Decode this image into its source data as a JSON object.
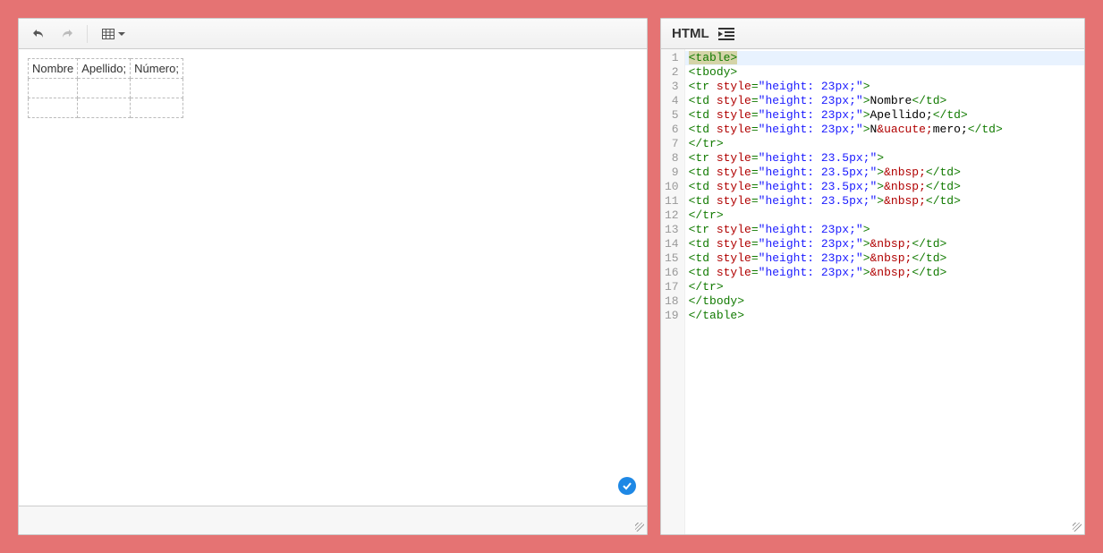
{
  "editor": {
    "table": {
      "rows": [
        {
          "cells": [
            "Nombre",
            "Apellido;",
            "Número;"
          ]
        },
        {
          "cells": [
            "",
            "",
            ""
          ]
        },
        {
          "cells": [
            "",
            "",
            ""
          ]
        }
      ]
    }
  },
  "code_panel": {
    "title": "HTML",
    "lines": [
      {
        "n": 1,
        "tokens": [
          {
            "t": "<table>",
            "c": "tag",
            "sel": true
          }
        ]
      },
      {
        "n": 2,
        "tokens": [
          {
            "t": "<tbody>",
            "c": "tag"
          }
        ]
      },
      {
        "n": 3,
        "tokens": [
          {
            "t": "<tr ",
            "c": "tag"
          },
          {
            "t": "style",
            "c": "attr"
          },
          {
            "t": "=",
            "c": "tag"
          },
          {
            "t": "\"height: 23px;\"",
            "c": "str"
          },
          {
            "t": ">",
            "c": "tag"
          }
        ]
      },
      {
        "n": 4,
        "tokens": [
          {
            "t": "<td ",
            "c": "tag"
          },
          {
            "t": "style",
            "c": "attr"
          },
          {
            "t": "=",
            "c": "tag"
          },
          {
            "t": "\"height: 23px;\"",
            "c": "str"
          },
          {
            "t": ">",
            "c": "tag"
          },
          {
            "t": "Nombre",
            "c": "text"
          },
          {
            "t": "</td>",
            "c": "tag"
          }
        ]
      },
      {
        "n": 5,
        "tokens": [
          {
            "t": "<td ",
            "c": "tag"
          },
          {
            "t": "style",
            "c": "attr"
          },
          {
            "t": "=",
            "c": "tag"
          },
          {
            "t": "\"height: 23px;\"",
            "c": "str"
          },
          {
            "t": ">",
            "c": "tag"
          },
          {
            "t": "Apellido;",
            "c": "text"
          },
          {
            "t": "</td>",
            "c": "tag"
          }
        ]
      },
      {
        "n": 6,
        "tokens": [
          {
            "t": "<td ",
            "c": "tag"
          },
          {
            "t": "style",
            "c": "attr"
          },
          {
            "t": "=",
            "c": "tag"
          },
          {
            "t": "\"height: 23px;\"",
            "c": "str"
          },
          {
            "t": ">",
            "c": "tag"
          },
          {
            "t": "N",
            "c": "text"
          },
          {
            "t": "&uacute;",
            "c": "ent"
          },
          {
            "t": "mero;",
            "c": "text"
          },
          {
            "t": "</td>",
            "c": "tag"
          }
        ]
      },
      {
        "n": 7,
        "tokens": [
          {
            "t": "</tr>",
            "c": "tag"
          }
        ]
      },
      {
        "n": 8,
        "tokens": [
          {
            "t": "<tr ",
            "c": "tag"
          },
          {
            "t": "style",
            "c": "attr"
          },
          {
            "t": "=",
            "c": "tag"
          },
          {
            "t": "\"height: 23.5px;\"",
            "c": "str"
          },
          {
            "t": ">",
            "c": "tag"
          }
        ]
      },
      {
        "n": 9,
        "tokens": [
          {
            "t": "<td ",
            "c": "tag"
          },
          {
            "t": "style",
            "c": "attr"
          },
          {
            "t": "=",
            "c": "tag"
          },
          {
            "t": "\"height: 23.5px;\"",
            "c": "str"
          },
          {
            "t": ">",
            "c": "tag"
          },
          {
            "t": "&nbsp;",
            "c": "ent"
          },
          {
            "t": "</td>",
            "c": "tag"
          }
        ]
      },
      {
        "n": 10,
        "tokens": [
          {
            "t": "<td ",
            "c": "tag"
          },
          {
            "t": "style",
            "c": "attr"
          },
          {
            "t": "=",
            "c": "tag"
          },
          {
            "t": "\"height: 23.5px;\"",
            "c": "str"
          },
          {
            "t": ">",
            "c": "tag"
          },
          {
            "t": "&nbsp;",
            "c": "ent"
          },
          {
            "t": "</td>",
            "c": "tag"
          }
        ]
      },
      {
        "n": 11,
        "tokens": [
          {
            "t": "<td ",
            "c": "tag"
          },
          {
            "t": "style",
            "c": "attr"
          },
          {
            "t": "=",
            "c": "tag"
          },
          {
            "t": "\"height: 23.5px;\"",
            "c": "str"
          },
          {
            "t": ">",
            "c": "tag"
          },
          {
            "t": "&nbsp;",
            "c": "ent"
          },
          {
            "t": "</td>",
            "c": "tag"
          }
        ]
      },
      {
        "n": 12,
        "tokens": [
          {
            "t": "</tr>",
            "c": "tag"
          }
        ]
      },
      {
        "n": 13,
        "tokens": [
          {
            "t": "<tr ",
            "c": "tag"
          },
          {
            "t": "style",
            "c": "attr"
          },
          {
            "t": "=",
            "c": "tag"
          },
          {
            "t": "\"height: 23px;\"",
            "c": "str"
          },
          {
            "t": ">",
            "c": "tag"
          }
        ]
      },
      {
        "n": 14,
        "tokens": [
          {
            "t": "<td ",
            "c": "tag"
          },
          {
            "t": "style",
            "c": "attr"
          },
          {
            "t": "=",
            "c": "tag"
          },
          {
            "t": "\"height: 23px;\"",
            "c": "str"
          },
          {
            "t": ">",
            "c": "tag"
          },
          {
            "t": "&nbsp;",
            "c": "ent"
          },
          {
            "t": "</td>",
            "c": "tag"
          }
        ]
      },
      {
        "n": 15,
        "tokens": [
          {
            "t": "<td ",
            "c": "tag"
          },
          {
            "t": "style",
            "c": "attr"
          },
          {
            "t": "=",
            "c": "tag"
          },
          {
            "t": "\"height: 23px;\"",
            "c": "str"
          },
          {
            "t": ">",
            "c": "tag"
          },
          {
            "t": "&nbsp;",
            "c": "ent"
          },
          {
            "t": "</td>",
            "c": "tag"
          }
        ]
      },
      {
        "n": 16,
        "tokens": [
          {
            "t": "<td ",
            "c": "tag"
          },
          {
            "t": "style",
            "c": "attr"
          },
          {
            "t": "=",
            "c": "tag"
          },
          {
            "t": "\"height: 23px;\"",
            "c": "str"
          },
          {
            "t": ">",
            "c": "tag"
          },
          {
            "t": "&nbsp;",
            "c": "ent"
          },
          {
            "t": "</td>",
            "c": "tag"
          }
        ]
      },
      {
        "n": 17,
        "tokens": [
          {
            "t": "</tr>",
            "c": "tag"
          }
        ]
      },
      {
        "n": 18,
        "tokens": [
          {
            "t": "</tbody>",
            "c": "tag"
          }
        ]
      },
      {
        "n": 19,
        "tokens": [
          {
            "t": "</table>",
            "c": "tag"
          }
        ]
      }
    ],
    "highlight_line_index": 0
  }
}
